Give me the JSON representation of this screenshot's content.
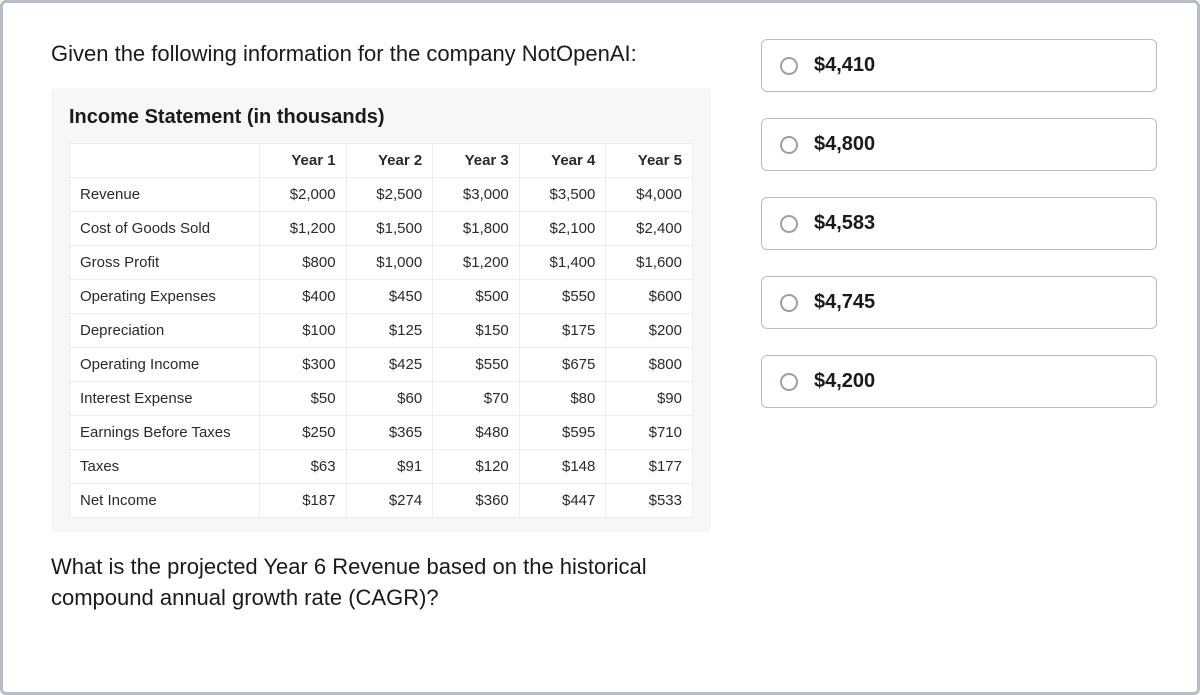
{
  "prompt": "Given the following information for the company NotOpenAI:",
  "question": "What is the projected Year 6 Revenue based on the historical compound annual growth rate (CAGR)?",
  "table": {
    "title": "Income Statement (in thousands)",
    "headers": [
      "",
      "Year 1",
      "Year 2",
      "Year 3",
      "Year 4",
      "Year 5"
    ],
    "rows": [
      {
        "label": "Revenue",
        "cells": [
          "$2,000",
          "$2,500",
          "$3,000",
          "$3,500",
          "$4,000"
        ]
      },
      {
        "label": "Cost of Goods Sold",
        "cells": [
          "$1,200",
          "$1,500",
          "$1,800",
          "$2,100",
          "$2,400"
        ]
      },
      {
        "label": "Gross Profit",
        "cells": [
          "$800",
          "$1,000",
          "$1,200",
          "$1,400",
          "$1,600"
        ]
      },
      {
        "label": "Operating Expenses",
        "cells": [
          "$400",
          "$450",
          "$500",
          "$550",
          "$600"
        ]
      },
      {
        "label": "Depreciation",
        "cells": [
          "$100",
          "$125",
          "$150",
          "$175",
          "$200"
        ]
      },
      {
        "label": "Operating Income",
        "cells": [
          "$300",
          "$425",
          "$550",
          "$675",
          "$800"
        ]
      },
      {
        "label": "Interest Expense",
        "cells": [
          "$50",
          "$60",
          "$70",
          "$80",
          "$90"
        ]
      },
      {
        "label": "Earnings Before Taxes",
        "cells": [
          "$250",
          "$365",
          "$480",
          "$595",
          "$710"
        ]
      },
      {
        "label": "Taxes",
        "cells": [
          "$63",
          "$91",
          "$120",
          "$148",
          "$177"
        ]
      },
      {
        "label": "Net Income",
        "cells": [
          "$187",
          "$274",
          "$360",
          "$447",
          "$533"
        ]
      }
    ]
  },
  "options": [
    {
      "label": "$4,410"
    },
    {
      "label": "$4,800"
    },
    {
      "label": "$4,583"
    },
    {
      "label": "$4,745"
    },
    {
      "label": "$4,200"
    }
  ]
}
